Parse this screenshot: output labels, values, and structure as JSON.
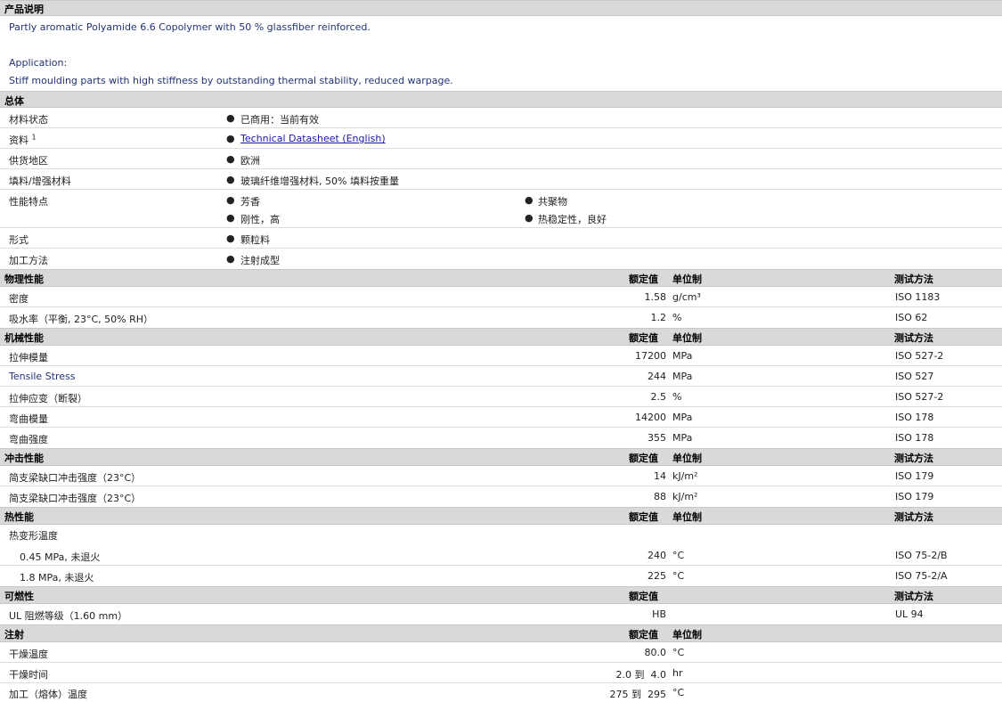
{
  "product_description": {
    "title": "产品说明",
    "line1": "Partly aromatic Polyamide 6.6 Copolymer with 50 % glassfiber reinforced.",
    "application_label": "Application:",
    "application_text": "Stiff moulding parts with high stiffness by outstanding thermal stability, reduced warpage."
  },
  "general": {
    "title": "总体",
    "bullet": "●",
    "rows": {
      "material_status": {
        "label": "材料状态",
        "value": "已商用：当前有效"
      },
      "literature": {
        "label": "资料",
        "sup": "1",
        "link": "Technical Datasheet (English)"
      },
      "availability": {
        "label": "供货地区",
        "value": "欧洲"
      },
      "filler": {
        "label": "填料/增强材料",
        "value": "玻璃纤维增强材料, 50% 填料按重量"
      },
      "features": {
        "label": "性能特点",
        "values": [
          "芳香",
          "共聚物",
          "刚性，高",
          "热稳定性，良好"
        ]
      },
      "form": {
        "label": "形式",
        "value": "颗粒料"
      },
      "processing": {
        "label": "加工方法",
        "value": "注射成型"
      }
    }
  },
  "headers": {
    "nominal": "额定值",
    "unit": "单位制",
    "method": "测试方法"
  },
  "physical": {
    "title": "物理性能",
    "rows": [
      {
        "label": "密度",
        "value": "1.58",
        "unit": "g/cm³",
        "method": "ISO 1183"
      },
      {
        "label": "吸水率（平衡, 23°C, 50% RH）",
        "value": "1.2",
        "unit": "%",
        "method": "ISO 62"
      }
    ]
  },
  "mechanical": {
    "title": "机械性能",
    "rows": [
      {
        "label": "拉伸模量",
        "value": "17200",
        "unit": "MPa",
        "method": "ISO 527-2"
      },
      {
        "label": "Tensile Stress",
        "value": "244",
        "unit": "MPa",
        "method": "ISO 527"
      },
      {
        "label": "拉伸应变（断裂）",
        "value": "2.5",
        "unit": "%",
        "method": "ISO 527-2"
      },
      {
        "label": "弯曲模量",
        "value": "14200",
        "unit": "MPa",
        "method": "ISO 178"
      },
      {
        "label": "弯曲强度",
        "value": "355",
        "unit": "MPa",
        "method": "ISO 178"
      }
    ]
  },
  "impact": {
    "title": "冲击性能",
    "rows": [
      {
        "label": "简支梁缺口冲击强度（23°C）",
        "value": "14",
        "unit": "kJ/m²",
        "method": "ISO 179"
      },
      {
        "label": "简支梁缺口冲击强度（23°C）",
        "value": "88",
        "unit": "kJ/m²",
        "method": "ISO 179"
      }
    ]
  },
  "thermal": {
    "title": "热性能",
    "group_label": "热变形温度",
    "rows": [
      {
        "label": "0.45 MPa, 未退火",
        "value": "240",
        "unit": "°C",
        "method": "ISO 75-2/B"
      },
      {
        "label": "1.8 MPa, 未退火",
        "value": "225",
        "unit": "°C",
        "method": "ISO 75-2/A"
      }
    ]
  },
  "flammability": {
    "title": "可燃性",
    "rows": [
      {
        "label": "UL 阻燃等级（1.60 mm）",
        "value": "HB",
        "method": "UL 94"
      }
    ]
  },
  "injection": {
    "title": "注射",
    "rows": [
      {
        "label": "干燥温度",
        "value": "80.0",
        "unit": "°C"
      },
      {
        "label": "干燥时间",
        "value": "2.0 到  4.0",
        "unit": "hr"
      },
      {
        "label": "加工（熔体）温度",
        "value": "275 到  295",
        "unit": "°C"
      }
    ]
  }
}
